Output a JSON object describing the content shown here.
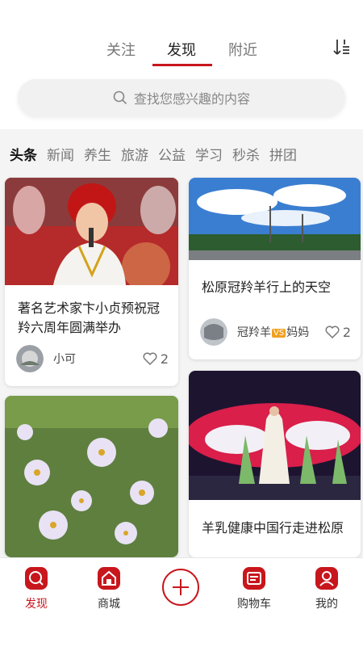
{
  "header": {
    "tabs": [
      {
        "label": "关注"
      },
      {
        "label": "发现",
        "active": true
      },
      {
        "label": "附近"
      }
    ],
    "sort_icon": "sort-icon"
  },
  "search": {
    "placeholder": "查找您感兴趣的内容",
    "icon": "search-icon"
  },
  "categories": [
    {
      "label": "头条",
      "active": true
    },
    {
      "label": "新闻"
    },
    {
      "label": "养生"
    },
    {
      "label": "旅游"
    },
    {
      "label": "公益"
    },
    {
      "label": "学习"
    },
    {
      "label": "秒杀"
    },
    {
      "label": "拼团"
    }
  ],
  "feed": [
    {
      "title": "著名艺术家卞小贞预祝冠羚六周年圆满举办",
      "author": "小可",
      "likes": "2"
    },
    {
      "title": "松原冠羚羊行上的天空",
      "author_prefix": "冠羚羊",
      "author_badge": "VS",
      "author_suffix": "妈妈",
      "likes": "2"
    },
    {
      "title": ""
    },
    {
      "title": "羊乳健康中国行走进松原"
    }
  ],
  "bottom_nav": [
    {
      "label": "发现",
      "icon": "discover-icon",
      "active": true
    },
    {
      "label": "商城",
      "icon": "shop-icon"
    },
    {
      "label": "",
      "icon": "plus-icon"
    },
    {
      "label": "购物车",
      "icon": "cart-icon"
    },
    {
      "label": "我的",
      "icon": "profile-icon"
    }
  ],
  "colors": {
    "accent": "#c8161d",
    "badge": "#f0a020"
  }
}
